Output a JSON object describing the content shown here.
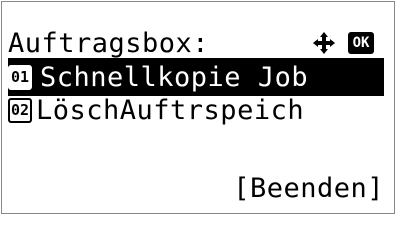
{
  "screen": {
    "title": "Auftragsbox:",
    "ok_label": "OK",
    "nav_icon": "four-way-arrow-icon"
  },
  "menu": {
    "items": [
      {
        "number": "01",
        "label": "Schnellkopie Job",
        "selected": true
      },
      {
        "number": "02",
        "label": "LöschAuftrspeich",
        "selected": false
      }
    ]
  },
  "footer": {
    "exit_label": "[Beenden]"
  },
  "colors": {
    "foreground": "#000000",
    "background": "#ffffff",
    "highlight": "#000000"
  }
}
